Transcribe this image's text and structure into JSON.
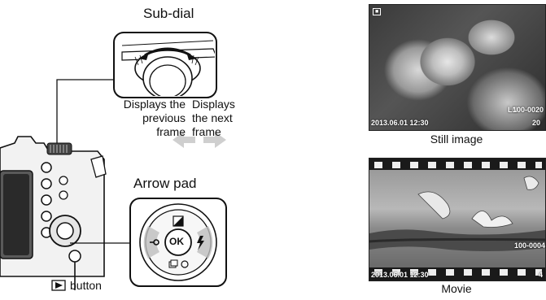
{
  "sub_dial": {
    "title": "Sub-dial"
  },
  "arrow_pad": {
    "title": "Arrow pad",
    "center_label": "OK"
  },
  "labels": {
    "prev": [
      "Displays the",
      "previous",
      "frame"
    ],
    "next": [
      "Displays",
      "the next",
      "frame"
    ]
  },
  "play_button": {
    "label": "button"
  },
  "still": {
    "caption": "Still image",
    "timestamp": "2013.06.01 12:30",
    "file_number": "100-0020",
    "quality": "LN",
    "count": "20"
  },
  "movie": {
    "caption": "Movie",
    "timestamp": "2013.06.01 12:30",
    "file_number": "100-0004",
    "count": "4"
  },
  "colors": {
    "arrow": "#cfcfcf",
    "dial_border": "#111111",
    "lcd": "#2a2a2a"
  }
}
